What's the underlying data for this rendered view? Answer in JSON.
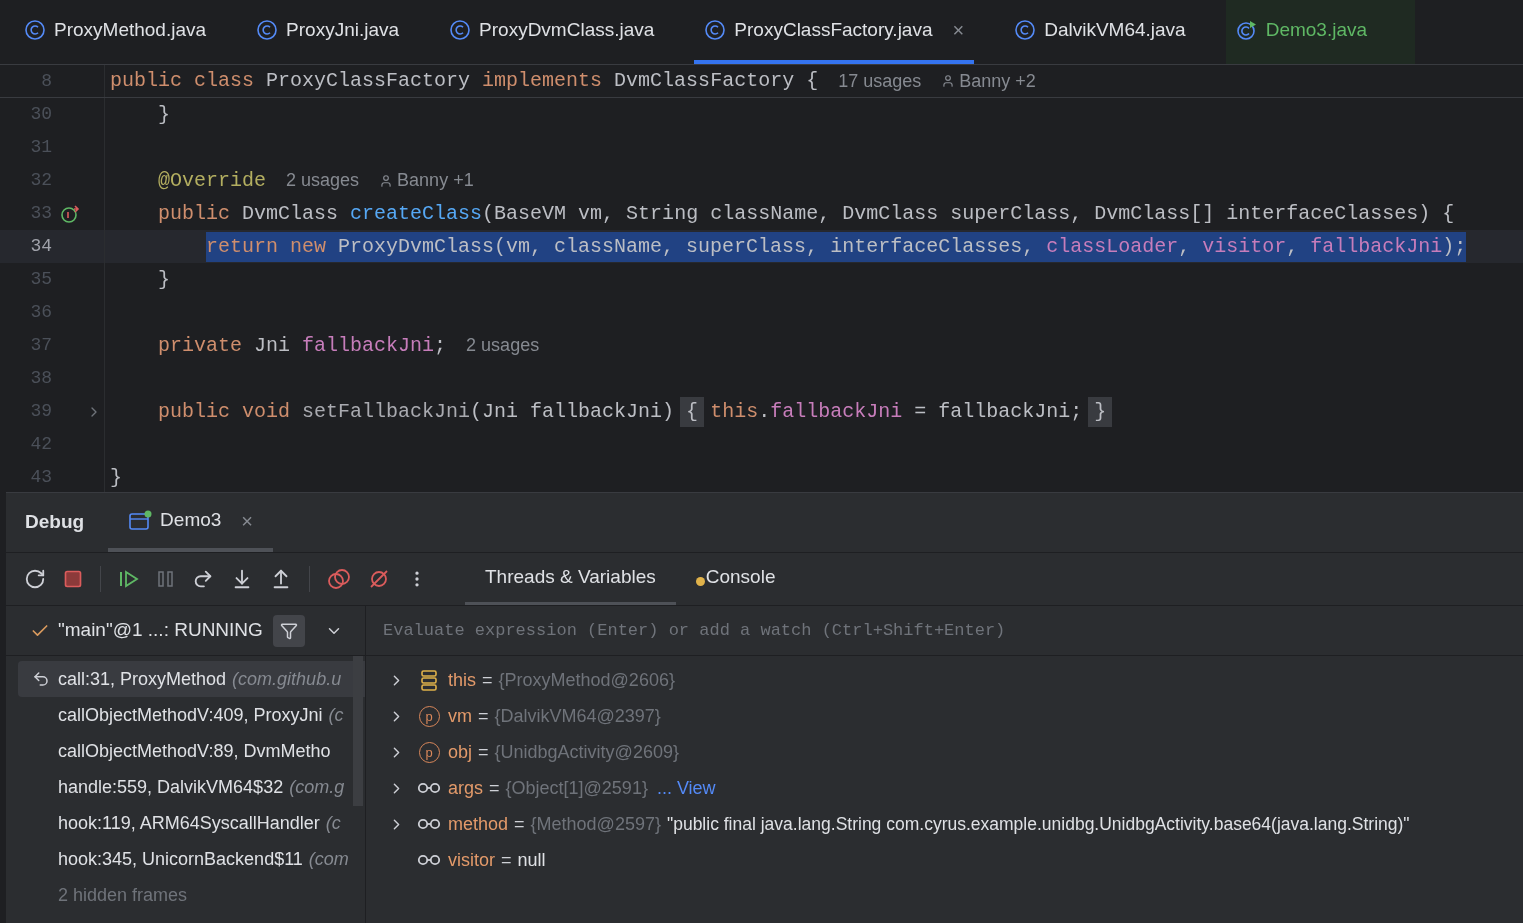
{
  "editor_tabs": [
    {
      "label": "ProxyMethod.java",
      "kind": "class",
      "selected": false
    },
    {
      "label": "ProxyJni.java",
      "kind": "class",
      "selected": false
    },
    {
      "label": "ProxyDvmClass.java",
      "kind": "class",
      "selected": false
    },
    {
      "label": "ProxyClassFactory.java",
      "kind": "class",
      "selected": true,
      "close": "×"
    },
    {
      "label": "DalvikVM64.java",
      "kind": "class",
      "selected": false
    },
    {
      "label": "Demo3.java",
      "kind": "runnable",
      "selected": false
    }
  ],
  "code_lines": [
    {
      "number": "8",
      "kind": "code",
      "sticky": true,
      "current": false,
      "tokens": [
        {
          "t": "public class ",
          "kind": "keyword"
        },
        {
          "t": "ProxyClassFactory ",
          "kind": "plain"
        },
        {
          "t": "implements ",
          "kind": "keyword"
        },
        {
          "t": "DvmClassFactory {",
          "kind": "plain"
        }
      ],
      "hint": "17 usages",
      "author": "Banny +2"
    },
    {
      "number": "30",
      "kind": "code",
      "sticky": false,
      "current": false,
      "tokens": [
        {
          "t": "    }",
          "kind": "plain"
        }
      ]
    },
    {
      "number": "31",
      "kind": "code",
      "sticky": false,
      "current": false
    },
    {
      "number": "32",
      "kind": "code",
      "sticky": false,
      "current": false,
      "tokens": [
        {
          "t": "    @Override",
          "kind": "annotation"
        }
      ],
      "hint": "2 usages",
      "author": "Banny +1"
    },
    {
      "number": "33",
      "kind": "override",
      "sticky": false,
      "current": false,
      "tokens": [
        {
          "t": "    public ",
          "kind": "keyword"
        },
        {
          "t": "DvmClass ",
          "kind": "plain"
        },
        {
          "t": "createClass",
          "kind": "method"
        },
        {
          "t": "(BaseVM vm, String className, DvmClass superClass, DvmClass[] interfaceClasses) {",
          "kind": "plain"
        }
      ]
    },
    {
      "number": "34",
      "kind": "code",
      "sticky": false,
      "current": true,
      "selection": true,
      "tokens": [
        {
          "t": "        return new ",
          "kind": "keyword"
        },
        {
          "t": "ProxyDvmClass(vm, className, superClass, interfaceClasses, ",
          "kind": "plain"
        },
        {
          "t": "classLoader",
          "kind": "field"
        },
        {
          "t": ", ",
          "kind": "plain"
        },
        {
          "t": "visitor",
          "kind": "field"
        },
        {
          "t": ", ",
          "kind": "plain"
        },
        {
          "t": "fallbackJni",
          "kind": "field"
        },
        {
          "t": ");",
          "kind": "plain"
        }
      ]
    },
    {
      "number": "35",
      "kind": "code",
      "sticky": false,
      "current": false,
      "tokens": [
        {
          "t": "    }",
          "kind": "plain"
        }
      ]
    },
    {
      "number": "36",
      "kind": "code",
      "sticky": false,
      "current": false
    },
    {
      "number": "37",
      "kind": "code",
      "sticky": false,
      "current": false,
      "tokens": [
        {
          "t": "    private ",
          "kind": "keyword"
        },
        {
          "t": "Jni ",
          "kind": "plain"
        },
        {
          "t": "fallbackJni",
          "kind": "field"
        },
        {
          "t": ";",
          "kind": "plain"
        }
      ],
      "hint": "2 usages"
    },
    {
      "number": "38",
      "kind": "code",
      "sticky": false,
      "current": false
    },
    {
      "number": "39",
      "kind": "fold",
      "sticky": false,
      "current": false,
      "tokens": [
        {
          "t": "    public void ",
          "kind": "keyword"
        },
        {
          "t": "setFallbackJni",
          "kind": "unused"
        },
        {
          "t": "(Jni fallbackJni)",
          "kind": "plain"
        },
        {
          "t": "{",
          "kind": "folded"
        },
        {
          "t": "this",
          "kind": "keyword"
        },
        {
          "t": ".",
          "kind": "plain"
        },
        {
          "t": "fallbackJni",
          "kind": "field"
        },
        {
          "t": " = fallbackJni;",
          "kind": "plain"
        },
        {
          "t": "}",
          "kind": "folded"
        }
      ]
    },
    {
      "number": "42",
      "kind": "code",
      "sticky": false,
      "current": false
    },
    {
      "number": "43",
      "kind": "code",
      "sticky": false,
      "current": false,
      "tokens": [
        {
          "t": "}",
          "kind": "plain"
        }
      ]
    }
  ],
  "debug": {
    "title": "Debug",
    "session_tab": {
      "label": "Demo3",
      "close": "×",
      "selected": true
    },
    "view_tabs": [
      {
        "label": "Threads & Variables",
        "selected": true
      },
      {
        "label": "Console",
        "selected": false
      }
    ],
    "thread": {
      "label": "\"main\"@1 ...: RUNNING"
    },
    "evaluate": {
      "placeholder": "Evaluate expression (Enter) or add a watch (Ctrl+Shift+Enter)"
    },
    "frames": [
      {
        "method": "call:31, ProxyMethod",
        "package": "(com.github.u",
        "selected": true
      },
      {
        "method": "callObjectMethodV:409, ProxyJni",
        "package": "(c",
        "selected": false
      },
      {
        "method": "callObjectMethodV:89, DvmMetho",
        "selected": false
      },
      {
        "method": "handle:559, DalvikVM64$32",
        "package": "(com.g",
        "selected": false
      },
      {
        "method": "hook:119, ARM64SyscallHandler",
        "package": "(c",
        "selected": false
      },
      {
        "method": "hook:345, UnicornBackend$11",
        "package": "(com",
        "selected": false
      }
    ],
    "hidden_frames": "2 hidden frames",
    "variables": [
      {
        "kind": "this",
        "name": "this",
        "operator": "=",
        "value": "{ProxyMethod@2606}",
        "expandable": true
      },
      {
        "kind": "param",
        "badge": "p",
        "name": "vm",
        "operator": "=",
        "value": "{DalvikVM64@2397}",
        "expandable": true
      },
      {
        "kind": "param",
        "badge": "p",
        "name": "obj",
        "operator": "=",
        "value": "{UnidbgActivity@2609}",
        "expandable": true
      },
      {
        "kind": "local",
        "name": "args",
        "operator": "=",
        "value": "{Object[1]@2591}",
        "link": "... View",
        "expandable": true
      },
      {
        "kind": "local",
        "name": "method",
        "operator": "=",
        "value": "{Method@2597}",
        "string": "\"public final java.lang.String com.cyrus.example.unidbg.UnidbgActivity.base64(java.lang.String)\"",
        "expandable": true
      },
      {
        "kind": "local",
        "name": "visitor",
        "operator": "=",
        "literal": "null",
        "expandable": false
      }
    ]
  }
}
